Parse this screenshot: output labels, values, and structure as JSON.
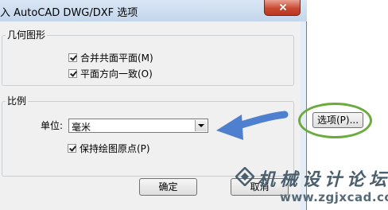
{
  "window": {
    "title": "入 AutoCAD DWG/DXF 选项"
  },
  "geometry_group": {
    "title": "几何图形",
    "merge_coplanar": {
      "label": "合并共面平面(M)",
      "checked": true
    },
    "planar_consistent": {
      "label": "平面方向一致(O)",
      "checked": true
    }
  },
  "scale_group": {
    "title": "比例",
    "unit_label": "单位:",
    "unit_value": "毫米",
    "keep_origin": {
      "label": "保持绘图原点(P)",
      "checked": true
    }
  },
  "buttons": {
    "options": "选项(P)...",
    "ok": "确定",
    "cancel": "取消"
  },
  "watermark": {
    "title": "机械设计论坛",
    "url": "www.zgjxcad.com"
  },
  "colors": {
    "annotation_arrow": "#4f7fcf",
    "highlight_ellipse": "#6aab3c"
  }
}
